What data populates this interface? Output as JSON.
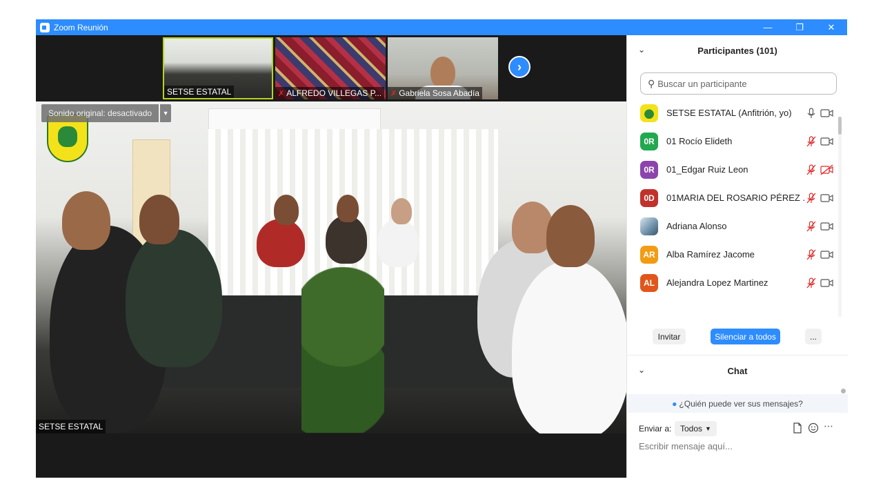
{
  "window": {
    "title": "Zoom Reunión",
    "controls": [
      "minimize",
      "restore",
      "close"
    ]
  },
  "thumbnails": [
    {
      "name": "SETSE ESTATAL",
      "muted": false,
      "active_speaker": true
    },
    {
      "name": "ALFREDO VILLEGAS P...",
      "muted": true,
      "active_speaker": false
    },
    {
      "name": "Gabriela Sosa Abadía",
      "muted": true,
      "active_speaker": false
    }
  ],
  "main_video": {
    "audio_label": "Sonido original: desactivado",
    "speaker_name": "SETSE ESTATAL"
  },
  "participants_panel": {
    "title": "Participantes (101)",
    "search_placeholder": "Buscar un participante",
    "participants": [
      {
        "initials": "",
        "name": "SETSE ESTATAL (Anfitrión, yo)",
        "avatar_color": "#f3e21a",
        "is_image_avatar": true,
        "mic": "on",
        "camera": "on"
      },
      {
        "initials": "0R",
        "name": "01 Rocío Elideth",
        "avatar_color": "#22a84f",
        "mic": "muted",
        "camera": "on"
      },
      {
        "initials": "0R",
        "name": "01_Edgar Ruiz Leon",
        "avatar_color": "#8b44ac",
        "mic": "muted",
        "camera": "off"
      },
      {
        "initials": "0D",
        "name": "01MARIA DEL ROSARIO PÉREZ ...",
        "avatar_color": "#c0322b",
        "mic": "muted",
        "camera": "on"
      },
      {
        "initials": "",
        "name": "Adriana Alonso",
        "avatar_color": "#6a8fa8",
        "is_image_avatar": true,
        "mic": "muted",
        "camera": "on"
      },
      {
        "initials": "AR",
        "name": "Alba Ramírez Jacome",
        "avatar_color": "#f29b13",
        "mic": "muted",
        "camera": "on"
      },
      {
        "initials": "AL",
        "name": "Alejandra Lopez Martinez",
        "avatar_color": "#e0561b",
        "mic": "muted",
        "camera": "on"
      }
    ],
    "invite_label": "Invitar",
    "mute_all_label": "Silenciar a todos",
    "more_label": "..."
  },
  "chat_panel": {
    "title": "Chat",
    "who_sees_label": "¿Quién puede ver sus mensajes?",
    "send_to_label": "Enviar a:",
    "recipient": "Todos",
    "message_placeholder": "Escribir mensaje aquí..."
  },
  "colors": {
    "titlebar": "#2d8cff",
    "accent": "#2d8cff",
    "muted_red": "#e02828"
  }
}
